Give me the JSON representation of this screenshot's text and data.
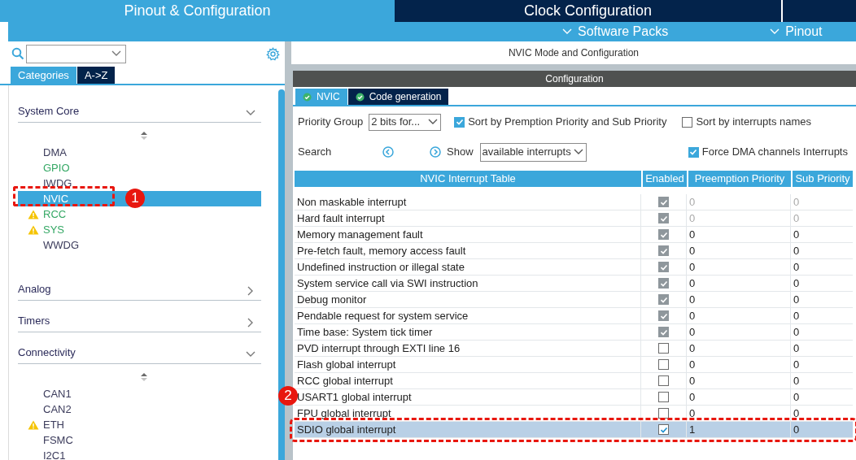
{
  "top_tabs": [
    {
      "label": "Pinout & Configuration",
      "selected": true
    },
    {
      "label": "Clock Configuration",
      "selected": false
    }
  ],
  "sub_menu": [
    {
      "label": "Software Packs"
    },
    {
      "label": "Pinout"
    }
  ],
  "sidebar": {
    "view_tabs": [
      {
        "label": "Categories",
        "selected": true
      },
      {
        "label": "A->Z",
        "selected": false
      }
    ],
    "categories": [
      {
        "name": "System Core",
        "expanded": true,
        "items": [
          {
            "name": "DMA",
            "configured": false,
            "warning": false,
            "selected": false
          },
          {
            "name": "GPIO",
            "configured": true,
            "warning": false,
            "selected": false
          },
          {
            "name": "IWDG",
            "configured": false,
            "warning": false,
            "selected": false
          },
          {
            "name": "NVIC",
            "configured": false,
            "warning": false,
            "selected": true,
            "callout": "1"
          },
          {
            "name": "RCC",
            "configured": true,
            "warning": true,
            "selected": false
          },
          {
            "name": "SYS",
            "configured": true,
            "warning": true,
            "selected": false
          },
          {
            "name": "WWDG",
            "configured": false,
            "warning": false,
            "selected": false
          }
        ]
      },
      {
        "name": "Analog",
        "expanded": false
      },
      {
        "name": "Timers",
        "expanded": false
      },
      {
        "name": "Connectivity",
        "expanded": true,
        "items": [
          {
            "name": "CAN1",
            "configured": false,
            "warning": false,
            "selected": false
          },
          {
            "name": "CAN2",
            "configured": false,
            "warning": false,
            "selected": false
          },
          {
            "name": "ETH",
            "configured": false,
            "warning": true,
            "selected": false
          },
          {
            "name": "FSMC",
            "configured": false,
            "warning": false,
            "selected": false
          },
          {
            "name": "I2C1",
            "configured": false,
            "warning": false,
            "selected": false
          }
        ]
      }
    ]
  },
  "panel": {
    "title": "NVIC Mode and Configuration",
    "section": "Configuration",
    "tabs": [
      {
        "label": "NVIC",
        "selected": true
      },
      {
        "label": "Code generation",
        "selected": false
      }
    ],
    "priority_group": {
      "label": "Priority Group",
      "value": "2 bits for..."
    },
    "sort_by_priority": {
      "label": "Sort by Premption Priority and Sub Priority",
      "checked": true
    },
    "sort_by_name": {
      "label": "Sort by interrupts names",
      "checked": false
    },
    "search_label": "Search",
    "show": {
      "label": "Show",
      "value": "available interrupts"
    },
    "force_dma": {
      "label": "Force DMA channels Interrupts",
      "checked": true
    },
    "table": {
      "columns": [
        "NVIC Interrupt Table",
        "Enabled",
        "Preemption Priority",
        "Sub Priority"
      ],
      "rows": [
        {
          "name": "Non maskable interrupt",
          "enabled": true,
          "locked": true,
          "priority_locked": true,
          "preemption": "0",
          "sub": "0",
          "selected": false
        },
        {
          "name": "Hard fault interrupt",
          "enabled": true,
          "locked": true,
          "priority_locked": true,
          "preemption": "0",
          "sub": "0",
          "selected": false
        },
        {
          "name": "Memory management fault",
          "enabled": true,
          "locked": true,
          "priority_locked": false,
          "preemption": "0",
          "sub": "0",
          "selected": false
        },
        {
          "name": "Pre-fetch fault, memory access fault",
          "enabled": true,
          "locked": true,
          "priority_locked": false,
          "preemption": "0",
          "sub": "0",
          "selected": false
        },
        {
          "name": "Undefined instruction or illegal state",
          "enabled": true,
          "locked": true,
          "priority_locked": false,
          "preemption": "0",
          "sub": "0",
          "selected": false
        },
        {
          "name": "System service call via SWI instruction",
          "enabled": true,
          "locked": true,
          "priority_locked": false,
          "preemption": "0",
          "sub": "0",
          "selected": false
        },
        {
          "name": "Debug monitor",
          "enabled": true,
          "locked": true,
          "priority_locked": false,
          "preemption": "0",
          "sub": "0",
          "selected": false
        },
        {
          "name": "Pendable request for system service",
          "enabled": true,
          "locked": true,
          "priority_locked": false,
          "preemption": "0",
          "sub": "0",
          "selected": false
        },
        {
          "name": "Time base: System tick timer",
          "enabled": true,
          "locked": true,
          "priority_locked": false,
          "preemption": "0",
          "sub": "0",
          "selected": false
        },
        {
          "name": "PVD interrupt through EXTI line 16",
          "enabled": false,
          "locked": false,
          "priority_locked": false,
          "preemption": "0",
          "sub": "0",
          "selected": false
        },
        {
          "name": "Flash global interrupt",
          "enabled": false,
          "locked": false,
          "priority_locked": false,
          "preemption": "0",
          "sub": "0",
          "selected": false
        },
        {
          "name": "RCC global interrupt",
          "enabled": false,
          "locked": false,
          "priority_locked": false,
          "preemption": "0",
          "sub": "0",
          "selected": false
        },
        {
          "name": "USART1 global interrupt",
          "enabled": false,
          "locked": false,
          "priority_locked": false,
          "preemption": "0",
          "sub": "0",
          "selected": false
        },
        {
          "name": "FPU global interrupt",
          "enabled": false,
          "locked": false,
          "priority_locked": false,
          "preemption": "0",
          "sub": "0",
          "selected": false
        },
        {
          "name": "SDIO global interrupt",
          "enabled": true,
          "locked": false,
          "priority_locked": false,
          "preemption": "1",
          "sub": "0",
          "selected": true,
          "callout": "2"
        }
      ]
    }
  }
}
